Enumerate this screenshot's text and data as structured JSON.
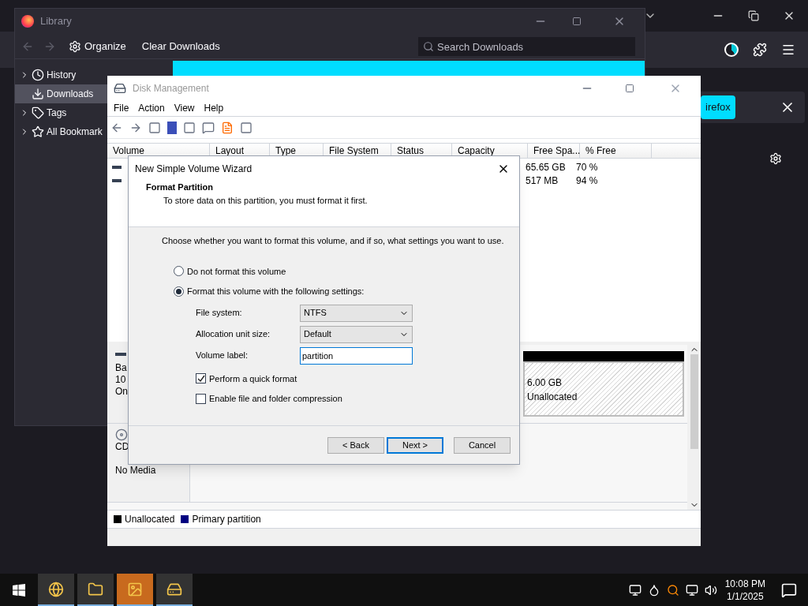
{
  "firefox": {
    "notification": {
      "button": "irefox"
    }
  },
  "library": {
    "title": "Library",
    "organize": "Organize",
    "clear": "Clear Downloads",
    "search": {
      "placeholder": "Search Downloads"
    },
    "sidebar": [
      {
        "label": "History",
        "expandable": true,
        "selected": false
      },
      {
        "label": "Downloads",
        "expandable": false,
        "selected": true
      },
      {
        "label": "Tags",
        "expandable": true,
        "selected": false
      },
      {
        "label": "All Bookmark",
        "expandable": true,
        "selected": false
      }
    ]
  },
  "disk_management": {
    "title": "Disk Management",
    "menu": [
      "File",
      "Action",
      "View",
      "Help"
    ],
    "columns": [
      "Volume",
      "Layout",
      "Type",
      "File System",
      "Status",
      "Capacity",
      "Free Spa...",
      "% Free"
    ],
    "rows": [
      {
        "free_space": "65.65 GB",
        "percent_free": "70 %"
      },
      {
        "free_space": "517 MB",
        "percent_free": "94 %"
      }
    ],
    "disks": [
      {
        "kind": "disk",
        "lines": [
          "Ba",
          "10",
          "On"
        ]
      },
      {
        "kind": "cdrom",
        "lines": [
          "CD",
          "No Media"
        ]
      }
    ],
    "unallocated": {
      "size": "6.00 GB",
      "label": "Unallocated"
    },
    "legend": [
      {
        "label": "Unallocated",
        "color": "#000000"
      },
      {
        "label": "Primary partition",
        "color": "#000080"
      }
    ]
  },
  "wizard": {
    "title": "New Simple Volume Wizard",
    "heading": "Format Partition",
    "subheading": "To store data on this partition, you must format it first.",
    "description": "Choose whether you want to format this volume, and if so, what settings you want to use.",
    "options": [
      {
        "label": "Do not format this volume",
        "selected": false
      },
      {
        "label": "Format this volume with the following settings:",
        "selected": true
      }
    ],
    "fields": [
      {
        "kind": "select",
        "label": "File system:",
        "value": "NTFS"
      },
      {
        "kind": "select",
        "label": "Allocation unit size:",
        "value": "Default"
      },
      {
        "kind": "text",
        "label": "Volume label:",
        "value": "partition"
      }
    ],
    "checkboxes": [
      {
        "label": "Perform a quick format",
        "checked": true
      },
      {
        "label": "Enable file and folder compression",
        "checked": false
      }
    ],
    "buttons": [
      {
        "label": "< Back",
        "default": false
      },
      {
        "label": "Next >",
        "default": true
      },
      {
        "label": "Cancel",
        "default": false
      }
    ]
  },
  "taskbar": {
    "apps": [
      {
        "selected": false
      },
      {
        "selected": false
      },
      {
        "selected": true
      },
      {
        "selected": false
      }
    ],
    "time": "10:08 PM",
    "date": "1/1/2025"
  }
}
